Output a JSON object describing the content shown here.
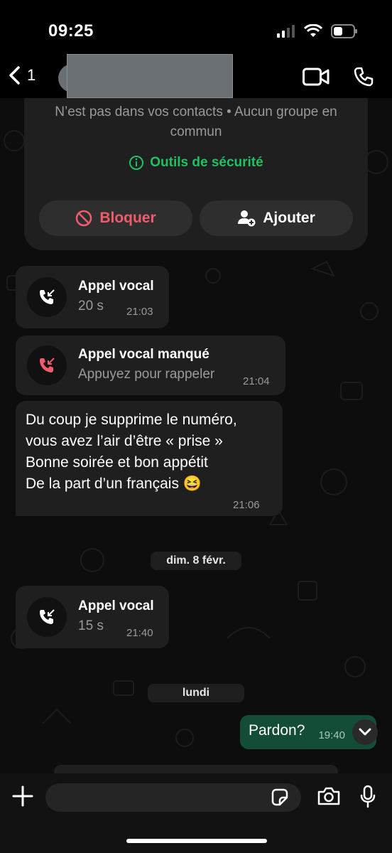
{
  "status_bar": {
    "time": "09:25",
    "signal_icon": "cellular-signal-icon",
    "wifi_icon": "wifi-icon",
    "battery_icon": "battery-icon"
  },
  "header": {
    "back_count": "1",
    "back_icon": "chevron-left-icon",
    "video_icon": "video-call-icon",
    "phone_icon": "phone-icon"
  },
  "contact_card": {
    "info_text": "N’est pas dans vos contacts • Aucun groupe en commun",
    "safety_tools_label": "Outils de sécurité",
    "block_label": "Bloquer",
    "add_label": "Ajouter",
    "colors": {
      "block": "#f15c6d",
      "safety": "#21c063"
    }
  },
  "messages": [
    {
      "type": "call",
      "title": "Appel vocal",
      "subtitle": "20 s",
      "time": "21:03",
      "icon": "incoming-call-icon"
    },
    {
      "type": "missed_call",
      "title": "Appel vocal manqué",
      "subtitle": "Appuyez pour rappeler",
      "time": "21:04",
      "icon": "missed-call-icon"
    },
    {
      "type": "text",
      "text": "Du coup je supprime le numéro,\nvous avez l’air d’être « prise »\nBonne soirée et bon appétit\nDe la part d’un français 😆",
      "time": "21:06"
    },
    {
      "type": "date",
      "label": "dim. 8 févr."
    },
    {
      "type": "call",
      "title": "Appel vocal",
      "subtitle": "15 s",
      "time": "21:40",
      "icon": "incoming-call-icon"
    },
    {
      "type": "date",
      "label": "lundi"
    },
    {
      "type": "outgoing_text",
      "text": "Pardon?",
      "time": "19:40"
    }
  ],
  "input_bar": {
    "placeholder": "",
    "plus_icon": "plus-icon",
    "sticker_icon": "sticker-icon",
    "camera_icon": "camera-icon",
    "mic_icon": "microphone-icon"
  },
  "theme": {
    "outgoing_bubble": "#134d37",
    "incoming_bubble": "#1f1f1f"
  }
}
